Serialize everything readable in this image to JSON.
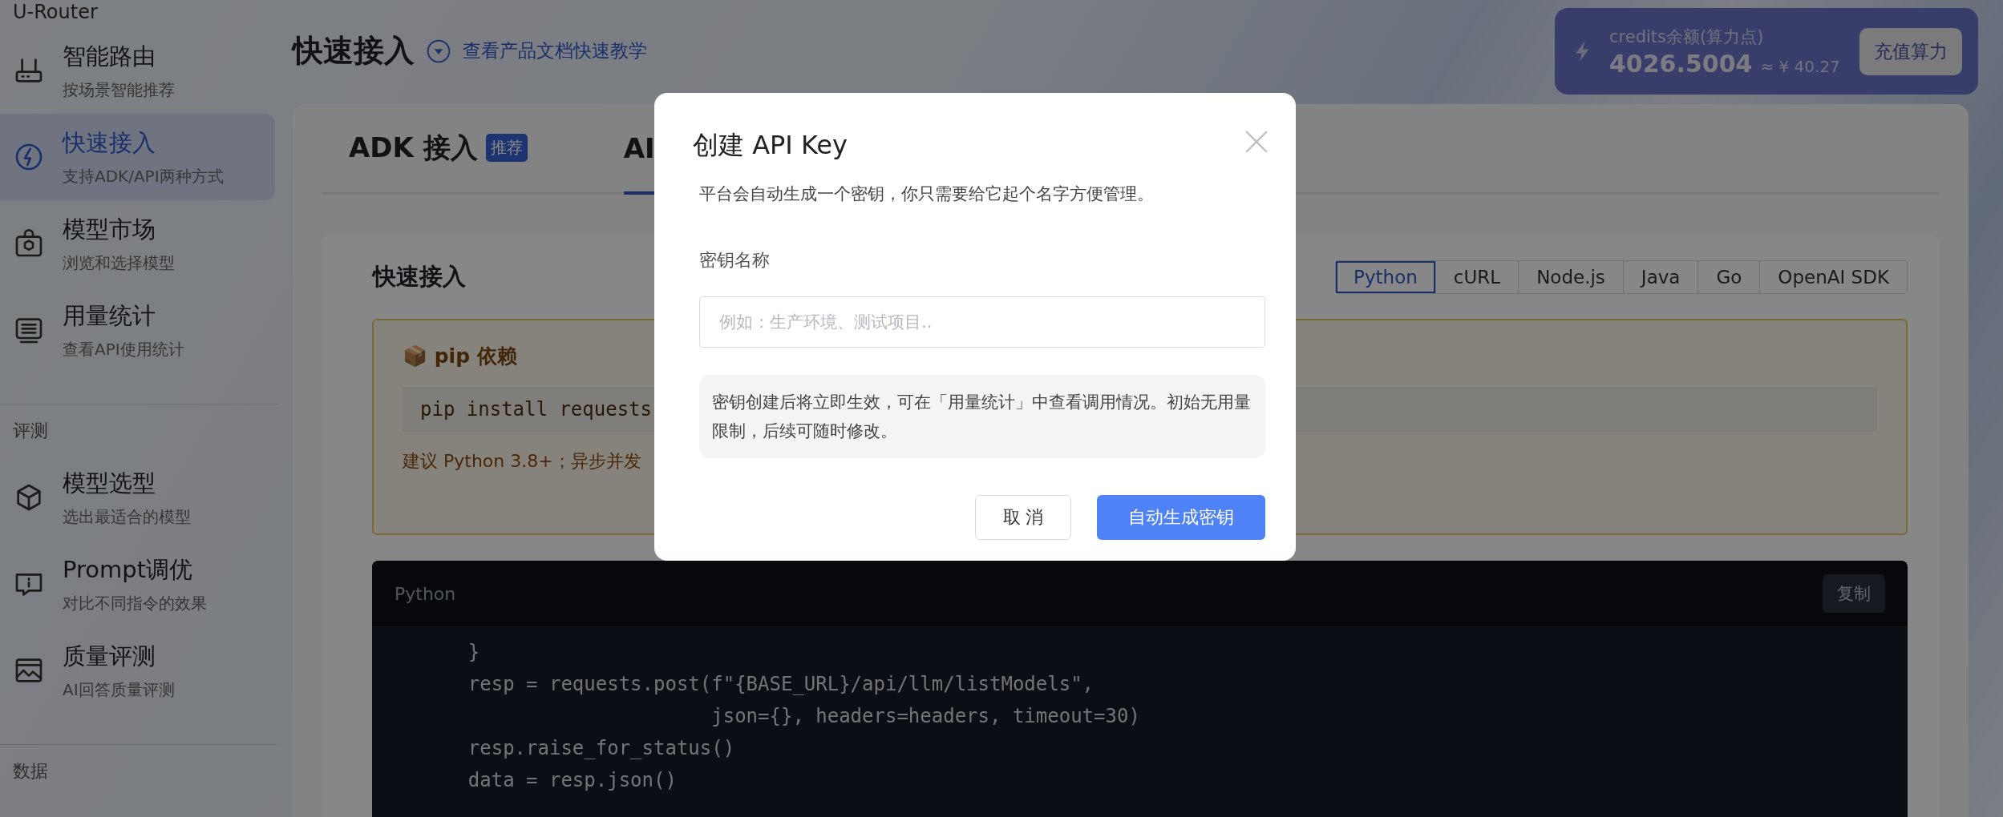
{
  "sidebar": {
    "brand": "U-Router",
    "groups": [
      {
        "items": [
          {
            "title": "智能路由",
            "subtitle": "按场景智能推荐",
            "selected": false
          },
          {
            "title": "快速接入",
            "subtitle": "支持ADK/API两种方式",
            "selected": true
          },
          {
            "title": "模型市场",
            "subtitle": "浏览和选择模型",
            "selected": false
          },
          {
            "title": "用量统计",
            "subtitle": "查看API使用统计",
            "selected": false
          }
        ]
      },
      {
        "heading": "评测",
        "items": [
          {
            "title": "模型选型",
            "subtitle": "选出最适合的模型",
            "selected": false
          },
          {
            "title": "Prompt调优",
            "subtitle": "对比不同指令的效果",
            "selected": false
          },
          {
            "title": "质量评测",
            "subtitle": "AI回答质量评测",
            "selected": false
          }
        ]
      },
      {
        "heading": "数据"
      }
    ]
  },
  "header": {
    "title": "快速接入",
    "doc_link": "查看产品文档快速教学"
  },
  "credits": {
    "label": "credits余额(算力点)",
    "amount": "4026.5004",
    "approx": "≈ ¥ 40.27",
    "button": "充值算力"
  },
  "tabs": [
    {
      "label": "ADK 接入",
      "badge": "推荐",
      "selected": false
    },
    {
      "label": "AI",
      "selected": true
    }
  ],
  "section": {
    "title": "快速接入",
    "languages": [
      {
        "label": "Python",
        "selected": true
      },
      {
        "label": "cURL",
        "selected": false
      },
      {
        "label": "Node.js",
        "selected": false
      },
      {
        "label": "Java",
        "selected": false
      },
      {
        "label": "Go",
        "selected": false
      },
      {
        "label": "OpenAI SDK",
        "selected": false
      }
    ]
  },
  "pip": {
    "title": "📦 pip 依赖",
    "command": "pip install requests",
    "note": "建议 Python 3.8+；异步并发"
  },
  "code": {
    "language": "Python",
    "copy": "复制",
    "lines": [
      "    }",
      "    resp = requests.post(f\"{BASE_URL}/api/llm/listModels\",",
      "                         json={}, headers=headers, timeout=30)",
      "    resp.raise_for_status()",
      "    data = resp.json()"
    ]
  },
  "modal": {
    "title": "创建 API Key",
    "description": "平台会自动生成一个密钥，你只需要给它起个名字方便管理。",
    "field_label": "密钥名称",
    "placeholder": "例如：生产环境、测试项目..",
    "notice": "密钥创建后将立即生效，可在「用量统计」中查看调用情况。初始无用量限制，后续可随时修改。",
    "cancel": "取 消",
    "confirm": "自动生成密钥"
  }
}
